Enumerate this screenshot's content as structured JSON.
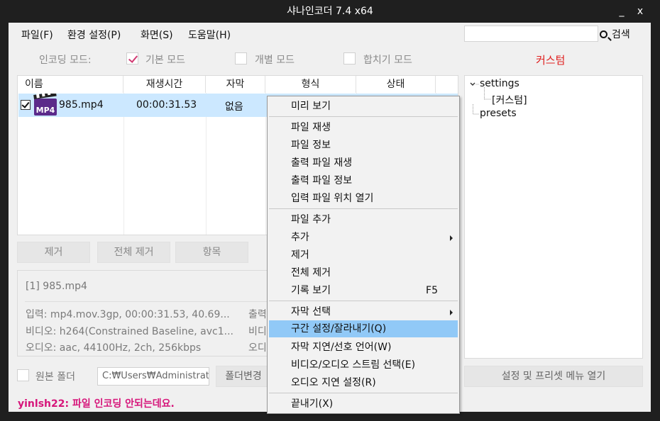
{
  "window": {
    "title": "샤나인코더  7.4 x64",
    "minimize": "_",
    "close": "x"
  },
  "menubar": {
    "items": [
      "파일(F)",
      "환경 설정(P)",
      "화면(S)",
      "도움말(H)"
    ],
    "search_label": "검색",
    "search_value": ""
  },
  "modes": {
    "label": "인코딩 모드:",
    "basic": "기본 모드",
    "basic_checked": true,
    "individual": "개별 모드",
    "merge": "합치기 모드",
    "custom_label": "커스텀"
  },
  "filelist": {
    "columns": [
      "이름",
      "재생시간",
      "자막",
      "형식",
      "상태"
    ],
    "rows": [
      {
        "checked": true,
        "icon_text": "MP4",
        "name": "985.mp4",
        "duration": "00:00:31.53",
        "subtitle": "없음",
        "format": "",
        "status": ""
      }
    ]
  },
  "tree": {
    "root": "settings",
    "child": "[커스텀]",
    "presets": "presets"
  },
  "buttons": {
    "remove": "제거",
    "remove_all": "전체 제거",
    "items": "항목",
    "change_folder": "폴더변경",
    "open_settings": "설정 및 프리셋 메뉴 열기"
  },
  "info": {
    "filename": "[1] 985.mp4",
    "input": "입력: mp4.mov.3gp, 00:00:31.53, 40.69...",
    "video": "비디오: h264(Constrained Baseline, avc1...",
    "audio": "오디오: aac, 44100Hz, 2ch, 256kbps",
    "output": "출력",
    "video2": "비디",
    "audio2": "오디"
  },
  "bottom": {
    "src_folder": "원본 폴더",
    "path": "C:₩Users₩Administrato"
  },
  "status": {
    "text": "yinlsh22: 파일 인코딩 안되는데요."
  },
  "context_menu": {
    "preview": "미리 보기",
    "play": "파일 재생",
    "info": "파일 정보",
    "out_play": "출력 파일 재생",
    "out_info": "출력 파일 정보",
    "open_loc": "입력 파일 위치 열기",
    "add_file": "파일 추가",
    "add": "추가",
    "remove": "제거",
    "remove_all": "전체 제거",
    "history": "기록 보기",
    "history_key": "F5",
    "sub_select": "자막 선택",
    "cut": "구간 설정/잘라내기(Q)",
    "sub_delay": "자막 지연/선호 언어(W)",
    "stream": "비디오/오디오 스트림 선택(E)",
    "audio_delay": "오디오 지연 설정(R)",
    "exit": "끝내기(X)"
  },
  "colors": {
    "titlebar": "#1f1f1f",
    "highlight": "#91c9f7",
    "row_selected": "#cce8ff",
    "custom_red": "#e0201f",
    "status_pink": "#d6157a"
  }
}
